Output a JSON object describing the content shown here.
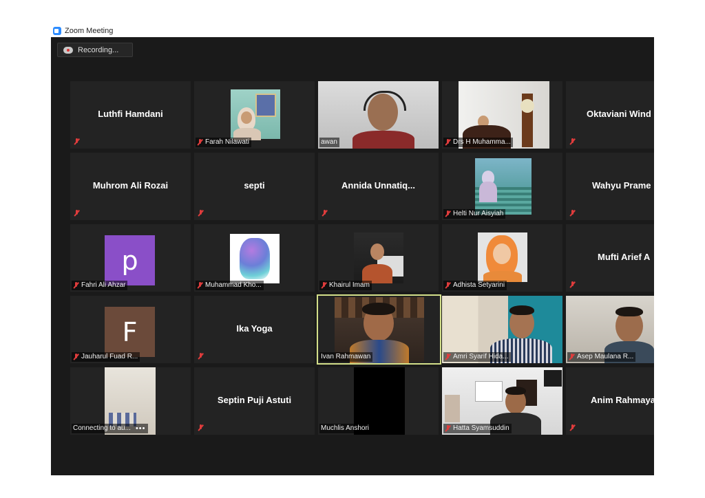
{
  "window": {
    "title": "Zoom Meeting",
    "recording_label": "Recording..."
  },
  "colors": {
    "accent": "#2d8cff",
    "muted": "#e03c3c",
    "active_speaker": "#d4e08a"
  },
  "participants": [
    {
      "label": "Luthfi Hamdani"
    },
    {
      "label": "Farah Nilawati"
    },
    {
      "label": "awan"
    },
    {
      "label": "Drs H Muhamma..."
    },
    {
      "label": "Oktaviani  Wind"
    },
    {
      "label": "Muhrom Ali Rozai"
    },
    {
      "label": "septi"
    },
    {
      "label": "Annida  Unnatiq..."
    },
    {
      "label": "Helti Nur Aisyiah"
    },
    {
      "label": "Wahyu Prame"
    },
    {
      "label": "Fahri Ali Ahzar",
      "avatar": "p"
    },
    {
      "label": "Muhammad Kho..."
    },
    {
      "label": "Khairul Imam"
    },
    {
      "label": "Adhista Setyarini"
    },
    {
      "label": "Mufti Arief A"
    },
    {
      "label": "Jauharul Fuad R...",
      "avatar": "F"
    },
    {
      "label": "Ika Yoga"
    },
    {
      "label": "Ivan Rahmawan"
    },
    {
      "label": "Amri Syarif Hida..."
    },
    {
      "label": "Asep Maulana R..."
    },
    {
      "label": "Connecting to au..."
    },
    {
      "label": "Septin Puji Astuti"
    },
    {
      "label": "Muchlis Anshori"
    },
    {
      "label": "Hatta Syamsuddin"
    },
    {
      "label": "Anim Rahmaya"
    }
  ]
}
